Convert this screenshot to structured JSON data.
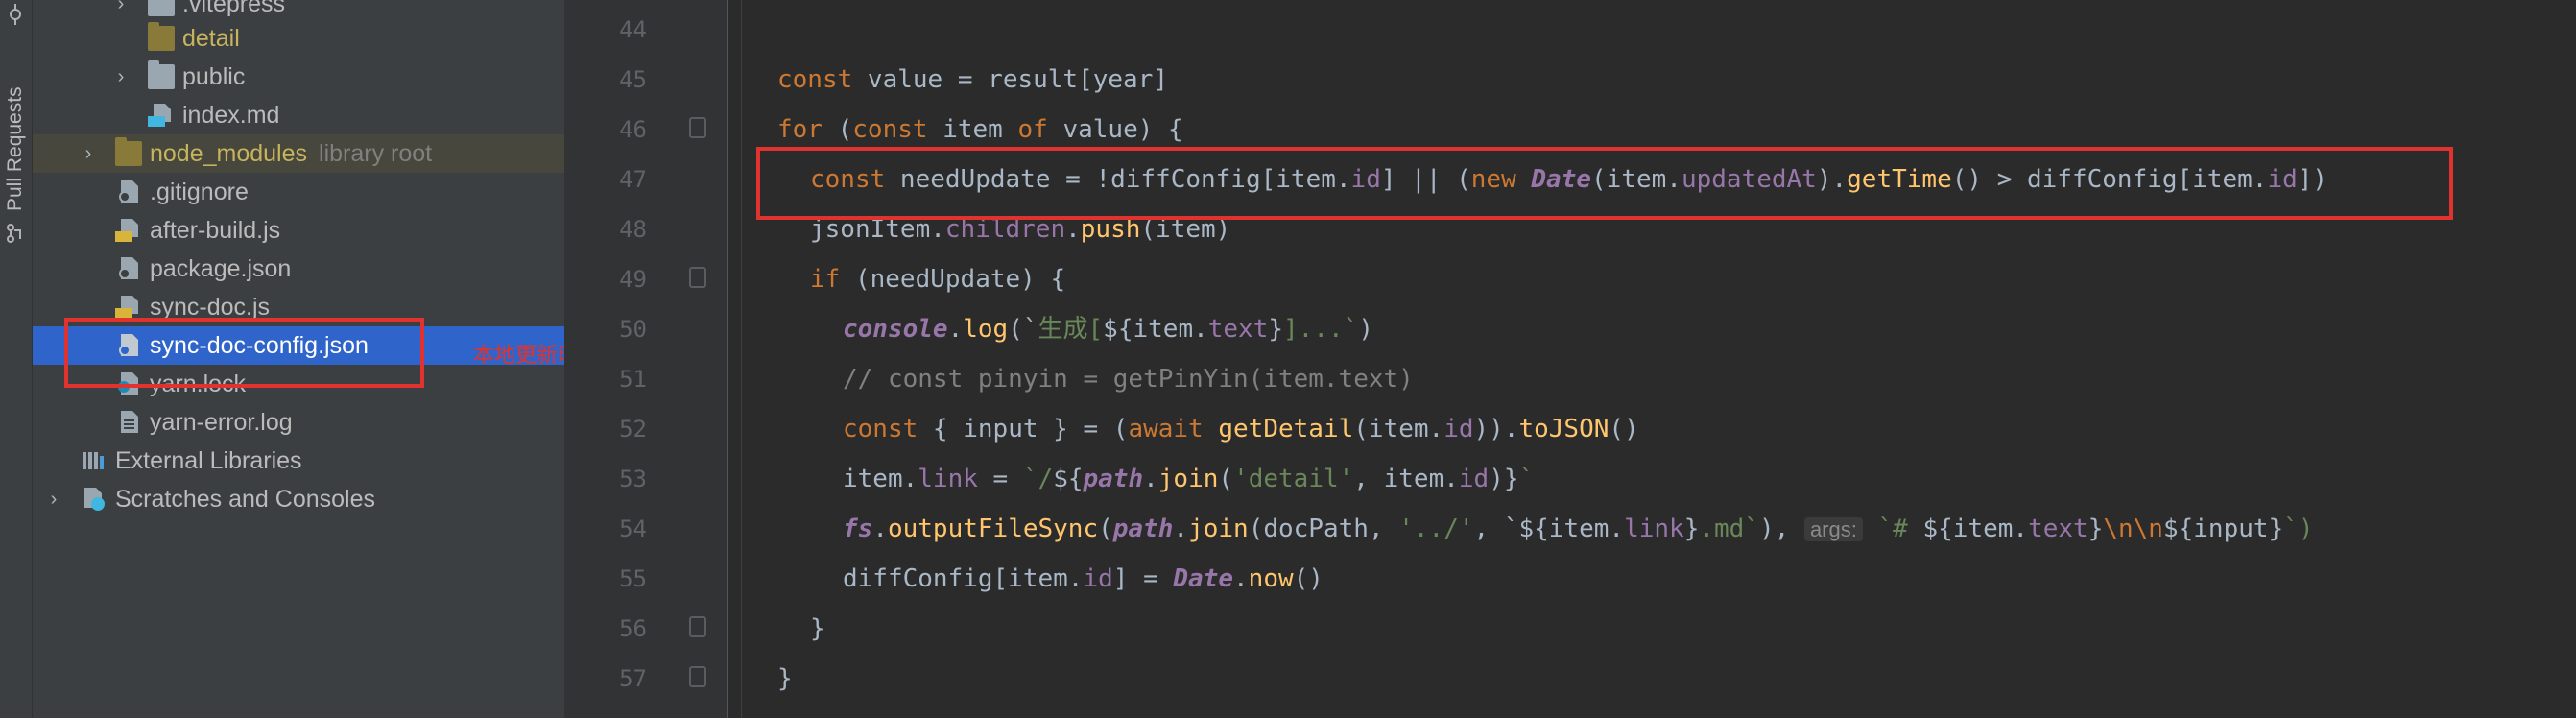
{
  "toolstrip": {
    "pull_requests_label": "Pull Requests"
  },
  "tree": {
    "items": [
      {
        "label": ".vitepress",
        "hint": ""
      },
      {
        "label": "detail",
        "hint": ""
      },
      {
        "label": "public",
        "hint": ""
      },
      {
        "label": "index.md",
        "hint": ""
      },
      {
        "label": "node_modules",
        "hint": "library root"
      },
      {
        "label": ".gitignore",
        "hint": ""
      },
      {
        "label": "after-build.js",
        "hint": ""
      },
      {
        "label": "package.json",
        "hint": ""
      },
      {
        "label": "sync-doc.js",
        "hint": ""
      },
      {
        "label": "sync-doc-config.json",
        "hint": ""
      },
      {
        "label": "yarn.lock",
        "hint": ""
      },
      {
        "label": "yarn-error.log",
        "hint": ""
      },
      {
        "label": "External Libraries",
        "hint": ""
      },
      {
        "label": "Scratches and Consoles",
        "hint": ""
      }
    ]
  },
  "annotation": {
    "note": "本地更新时间"
  },
  "editor": {
    "line_numbers": [
      "44",
      "45",
      "46",
      "47",
      "48",
      "49",
      "50",
      "51",
      "52",
      "53",
      "54",
      "55",
      "56",
      "57"
    ],
    "lines": {
      "l45": {
        "a": "const",
        "b": " value = result[year]"
      },
      "l46": {
        "a": "for",
        "b": " (",
        "c": "const",
        "d": " item ",
        "e": "of",
        "f": " value) {"
      },
      "l47": {
        "a": "const",
        "b": " needUpdate = !diffConfig[item.",
        "c": "id",
        "d": "] || (",
        "e": "new",
        "f": " ",
        "g": "Date",
        "h": "(item.",
        "i": "updatedAt",
        "j": ").",
        "k": "getTime",
        "l": "() > diffConfig[item.",
        "m": "id",
        "n": "])"
      },
      "l48": {
        "a": "jsonItem.",
        "b": "children",
        "c": ".",
        "d": "push",
        "e": "(item)"
      },
      "l49": {
        "a": "if",
        "b": " (needUpdate) {"
      },
      "l50": {
        "a": "console",
        "b": ".",
        "c": "log",
        "d": "(`",
        "e": "生成[",
        "f": "${item.",
        "g": "text",
        "h": "}",
        "i": "]...`",
        "j": ")"
      },
      "l51": {
        "a": "// const pinyin = getPinYin(item.text)"
      },
      "l52": {
        "a": "const",
        "b": " { input } = (",
        "c": "await",
        "d": " ",
        "e": "getDetail",
        "f": "(item.",
        "g": "id",
        "h": ")).",
        "i": "toJSON",
        "j": "()"
      },
      "l53": {
        "a": "item.",
        "b": "link",
        "c": " = ",
        "d": "`/",
        "e": "${",
        "f": "path",
        "g": ".",
        "h": "join",
        "i": "(",
        "j": "'detail'",
        "k": ", item.",
        "l": "id",
        "m": ")}",
        "n": "`"
      },
      "l54": {
        "a": "fs",
        "b": ".",
        "c": "outputFileSync",
        "d": "(",
        "e": "path",
        "f": ".",
        "g": "join",
        "h": "(docPath, ",
        "i": "'../'",
        "j": ", `",
        "k": "${item.",
        "l": "link",
        "m": "}",
        "n": ".md`",
        "o": "),",
        "p": "args:",
        "q": "`# ",
        "r": "${item.",
        "s": "text",
        "t": "}",
        "u": "\\n\\n",
        "v": "${input}",
        "w": "`)"
      },
      "l55": {
        "a": "diffConfig[item.",
        "b": "id",
        "c": "] = ",
        "d": "Date",
        "e": ".",
        "f": "now",
        "g": "()"
      },
      "l56": {
        "a": "}"
      },
      "l57": {
        "a": "}"
      }
    }
  },
  "colors": {
    "accent_selection": "#2f65ca",
    "annotation_red": "#e0322e",
    "keyword": "#cc7832",
    "function": "#ffc66d",
    "string": "#6a8759",
    "property": "#9876aa"
  },
  "icons": [
    "pull-requests-icon",
    "commit-icon",
    "folder-icon",
    "markdown-file-icon",
    "js-file-icon",
    "json-file-icon",
    "gitignore-file-icon",
    "lock-file-icon",
    "log-file-icon",
    "library-icon",
    "scratches-icon",
    "chevron-right-icon",
    "fold-marker-icon"
  ]
}
